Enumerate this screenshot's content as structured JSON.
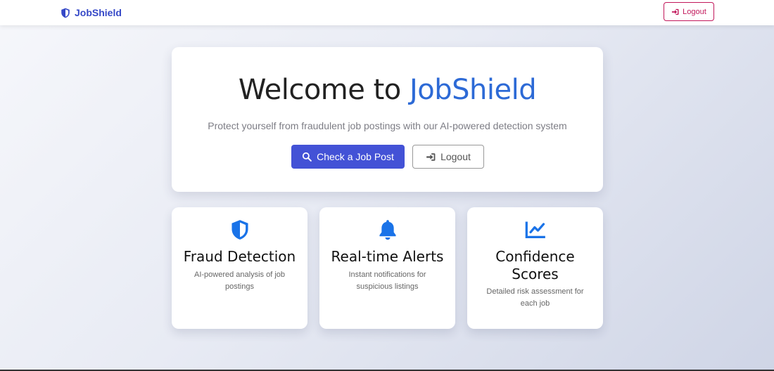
{
  "navbar": {
    "brand": "JobShield",
    "logout_label": "Logout"
  },
  "hero": {
    "title_prefix": "Welcome to ",
    "title_accent": "JobShield",
    "subtitle": "Protect yourself from fraudulent job postings with our AI-powered detection system",
    "check_button": "Check a Job Post",
    "logout_button": "Logout"
  },
  "features": [
    {
      "icon": "shield-icon",
      "title": "Fraud Detection",
      "description": "AI-powered analysis of job postings"
    },
    {
      "icon": "bell-icon",
      "title": "Real-time Alerts",
      "description": "Instant notifications for suspicious listings"
    },
    {
      "icon": "chart-line-icon",
      "title": "Confidence Scores",
      "description": "Detailed risk assessment for each job"
    }
  ],
  "colors": {
    "brand": "#3548c7",
    "accent": "#2d6ad6",
    "primary_button": "#4352d6",
    "logout": "#c2185b",
    "icon": "#1a73e8"
  }
}
